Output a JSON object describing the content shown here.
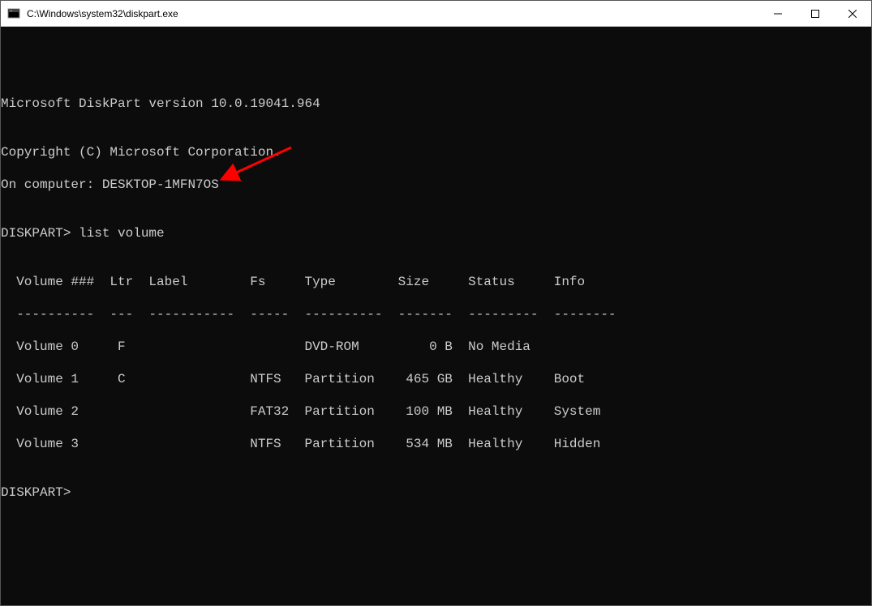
{
  "window": {
    "title": "C:\\Windows\\system32\\diskpart.exe"
  },
  "console": {
    "blank0": "",
    "version_line": "Microsoft DiskPart version 10.0.19041.964",
    "blank1": "",
    "copyright_line": "Copyright (C) Microsoft Corporation.",
    "computer_line": "On computer: DESKTOP-1MFN7OS",
    "blank2": "",
    "prompt1": "DISKPART> list volume",
    "blank3": "",
    "header": "  Volume ###  Ltr  Label        Fs     Type        Size     Status     Info",
    "divider": "  ----------  ---  -----------  -----  ----------  -------  ---------  --------",
    "row0": "  Volume 0     F                       DVD-ROM         0 B  No Media",
    "row1": "  Volume 1     C                NTFS   Partition    465 GB  Healthy    Boot",
    "row2": "  Volume 2                      FAT32  Partition    100 MB  Healthy    System",
    "row3": "  Volume 3                      NTFS   Partition    534 MB  Healthy    Hidden",
    "blank4": "",
    "prompt2": "DISKPART>"
  },
  "volumes_structured": [
    {
      "num": 0,
      "ltr": "F",
      "label": "",
      "fs": "",
      "type": "DVD-ROM",
      "size": "0 B",
      "status": "No Media",
      "info": ""
    },
    {
      "num": 1,
      "ltr": "C",
      "label": "",
      "fs": "NTFS",
      "type": "Partition",
      "size": "465 GB",
      "status": "Healthy",
      "info": "Boot"
    },
    {
      "num": 2,
      "ltr": "",
      "label": "",
      "fs": "FAT32",
      "type": "Partition",
      "size": "100 MB",
      "status": "Healthy",
      "info": "System"
    },
    {
      "num": 3,
      "ltr": "",
      "label": "",
      "fs": "NTFS",
      "type": "Partition",
      "size": "534 MB",
      "status": "Healthy",
      "info": "Hidden"
    }
  ]
}
